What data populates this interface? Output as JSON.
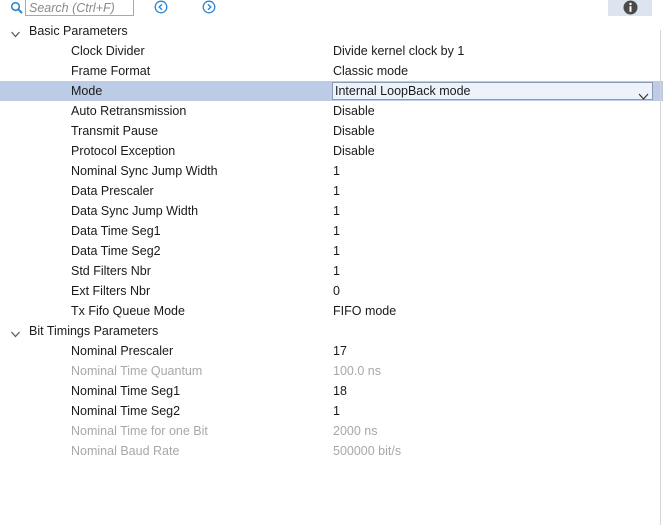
{
  "toolbar": {
    "search_placeholder": "Search (Ctrl+F)",
    "search_value": ""
  },
  "sections": [
    {
      "title": "Basic Parameters",
      "params": [
        {
          "label": "Clock Divider",
          "value": "Divide kernel clock by 1"
        },
        {
          "label": "Frame Format",
          "value": "Classic mode"
        },
        {
          "label": "Mode",
          "value": "Internal LoopBack mode"
        },
        {
          "label": "Auto Retransmission",
          "value": "Disable"
        },
        {
          "label": "Transmit Pause",
          "value": "Disable"
        },
        {
          "label": "Protocol Exception",
          "value": "Disable"
        },
        {
          "label": "Nominal Sync Jump Width",
          "value": "1"
        },
        {
          "label": "Data Prescaler",
          "value": "1"
        },
        {
          "label": "Data Sync Jump Width",
          "value": "1"
        },
        {
          "label": "Data Time Seg1",
          "value": "1"
        },
        {
          "label": "Data Time Seg2",
          "value": "1"
        },
        {
          "label": "Std Filters Nbr",
          "value": "1"
        },
        {
          "label": "Ext Filters Nbr",
          "value": "0"
        },
        {
          "label": "Tx Fifo Queue Mode",
          "value": "FIFO mode"
        }
      ]
    },
    {
      "title": "Bit Timings Parameters",
      "params": [
        {
          "label": "Nominal Prescaler",
          "value": "17"
        },
        {
          "label": "Nominal Time Quantum",
          "value": "100.0 ns"
        },
        {
          "label": "Nominal Time Seg1",
          "value": "18"
        },
        {
          "label": "Nominal Time Seg2",
          "value": "1"
        },
        {
          "label": "Nominal Time for one Bit",
          "value": "2000 ns"
        },
        {
          "label": "Nominal Baud Rate",
          "value": "500000 bit/s"
        }
      ]
    }
  ],
  "colors": {
    "selected_row": "#bccce6",
    "disabled_text": "#a8a8a8",
    "icon_blue": "#2f86d1"
  }
}
